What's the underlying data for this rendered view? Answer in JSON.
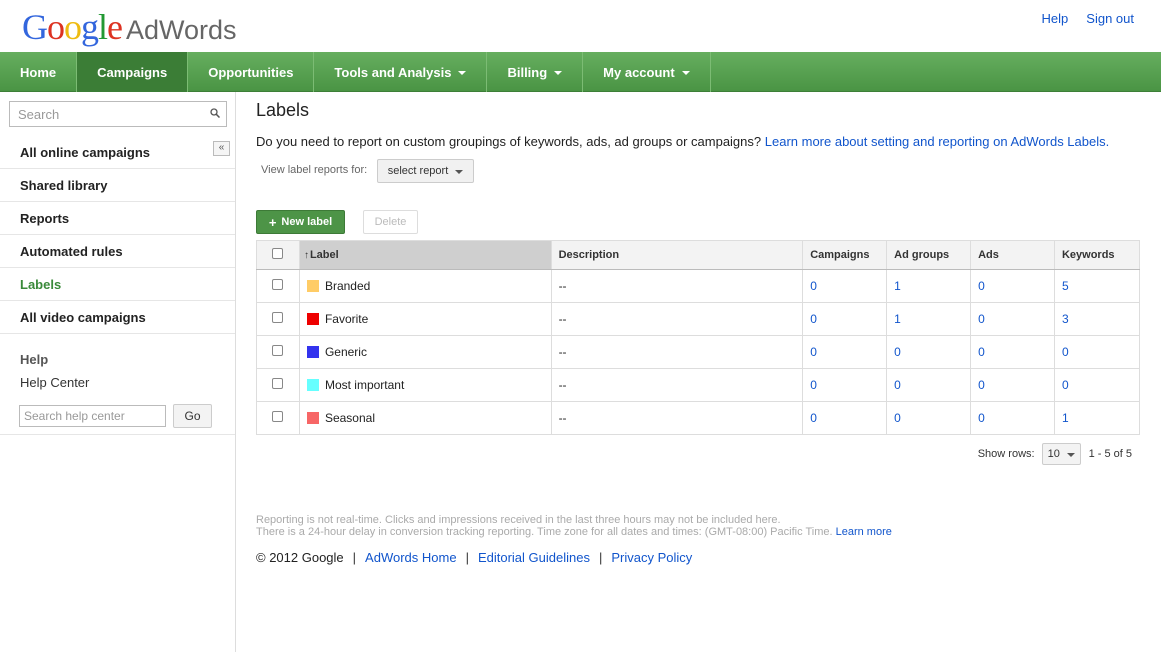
{
  "header": {
    "logo_google": "Google",
    "logo_adwords": "AdWords",
    "help": "Help",
    "sign_out": "Sign out"
  },
  "nav": {
    "items": [
      {
        "label": "Home",
        "dropdown": false,
        "active": false
      },
      {
        "label": "Campaigns",
        "dropdown": false,
        "active": true
      },
      {
        "label": "Opportunities",
        "dropdown": false,
        "active": false
      },
      {
        "label": "Tools and Analysis",
        "dropdown": true,
        "active": false
      },
      {
        "label": "Billing",
        "dropdown": true,
        "active": false
      },
      {
        "label": "My account",
        "dropdown": true,
        "active": false
      }
    ]
  },
  "sidebar": {
    "search_placeholder": "Search",
    "collapse_glyph": "«",
    "items": [
      "All online campaigns",
      "Shared library",
      "Reports",
      "Automated rules",
      "Labels",
      "All video campaigns"
    ],
    "active_index": 4,
    "help_title": "Help",
    "help_center": "Help Center",
    "help_search_placeholder": "Search help center",
    "go": "Go"
  },
  "main": {
    "title": "Labels",
    "intro_text": "Do you need to report on custom groupings of keywords, ads, ad groups or campaigns?",
    "intro_link": "Learn more about setting and reporting on AdWords Labels.",
    "view_label": "View label reports for:",
    "select_report": "select report",
    "new_label": "New label",
    "delete": "Delete",
    "columns": [
      "Label",
      "Description",
      "Campaigns",
      "Ad groups",
      "Ads",
      "Keywords"
    ],
    "rows": [
      {
        "label": "Branded",
        "color": "#ffcc66",
        "description": "--",
        "campaigns": "0",
        "ad_groups": "1",
        "ads": "0",
        "keywords": "5"
      },
      {
        "label": "Favorite",
        "color": "#ee0000",
        "description": "--",
        "campaigns": "0",
        "ad_groups": "1",
        "ads": "0",
        "keywords": "3"
      },
      {
        "label": "Generic",
        "color": "#3333ee",
        "description": "--",
        "campaigns": "0",
        "ad_groups": "0",
        "ads": "0",
        "keywords": "0"
      },
      {
        "label": "Most important",
        "color": "#66ffff",
        "description": "--",
        "campaigns": "0",
        "ad_groups": "0",
        "ads": "0",
        "keywords": "0"
      },
      {
        "label": "Seasonal",
        "color": "#f76666",
        "description": "--",
        "campaigns": "0",
        "ad_groups": "0",
        "ads": "0",
        "keywords": "1"
      }
    ],
    "show_rows_label": "Show rows:",
    "rows_value": "10",
    "range": "1 - 5 of 5",
    "note_line1": "Reporting is not real-time. Clicks and impressions received in the last three hours may not be included here.",
    "note_line2": "There is a 24-hour delay in conversion tracking reporting. Time zone for all dates and times: (GMT-08:00) Pacific Time.",
    "note_link": "Learn more"
  },
  "footer": {
    "copyright": "© 2012 Google",
    "links": [
      "AdWords Home",
      "Editorial Guidelines",
      "Privacy Policy"
    ]
  },
  "colors": {
    "nav_green": "#4f9d4f",
    "active_nav": "#3b7d36",
    "link_blue": "#1155cc",
    "active_side": "#3a8a3a"
  }
}
